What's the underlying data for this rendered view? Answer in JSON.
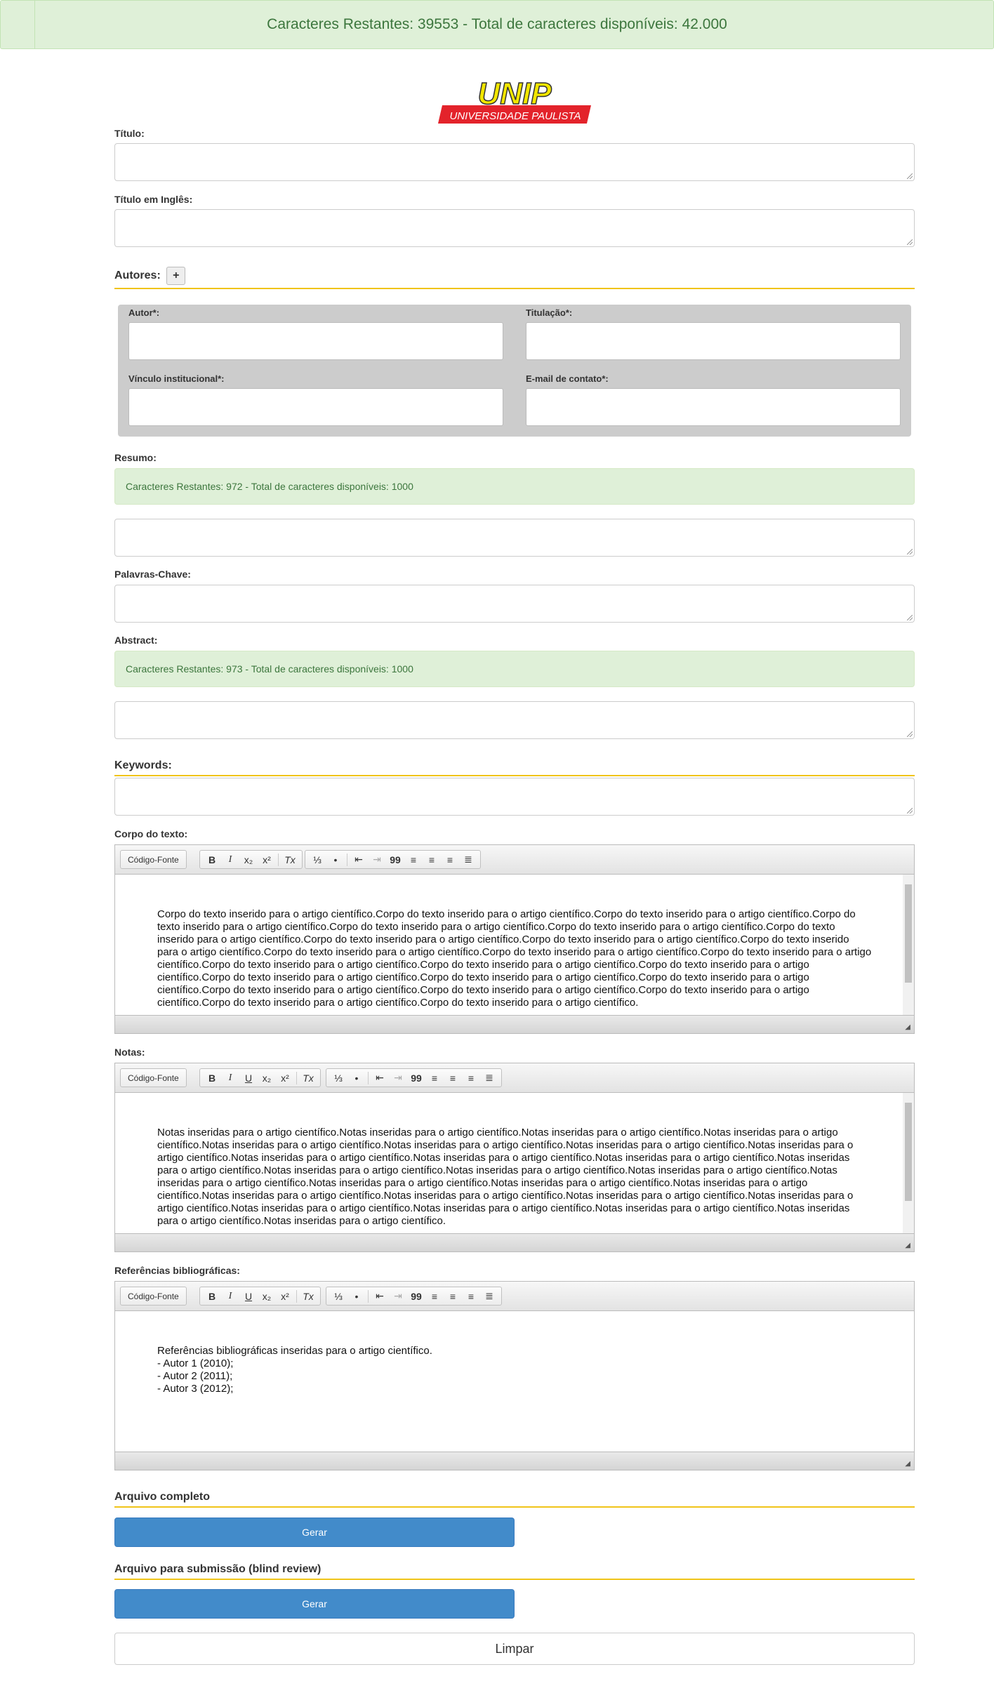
{
  "top_counter": "Caracteres Restantes: 39553 - Total de caracteres disponíveis: 42.000",
  "logo": {
    "name": "UNIP",
    "subtitle": "UNIVERSIDADE PAULISTA",
    "colors": {
      "yellow": "#f2e600",
      "red": "#e3232b"
    }
  },
  "fields": {
    "titulo": {
      "label": "Título:",
      "value": ""
    },
    "titulo_en": {
      "label": "Título em Inglês:",
      "value": ""
    },
    "palavras": {
      "label": "Palavras-Chave:",
      "value": ""
    }
  },
  "authors": {
    "heading": "Autores:",
    "add_label": "+",
    "autor": "Autor*:",
    "titulacao": "Titulação*:",
    "vinculo": "Vínculo institucional*:",
    "email": "E-mail de contato*:"
  },
  "resumo": {
    "label": "Resumo:",
    "counter": "Caracteres Restantes: 972 - Total de caracteres disponíveis: 1000"
  },
  "abstract": {
    "label": "Abstract:",
    "counter": "Caracteres Restantes: 973 - Total de caracteres disponíveis: 1000"
  },
  "keywords": {
    "heading": "Keywords:"
  },
  "toolbar": {
    "source": "Código-Fonte",
    "bold": "B",
    "italic": "I",
    "underline": "U",
    "sub": "x₂",
    "sup": "x²",
    "clear": "Tx",
    "ol": "⅓",
    "ul": "•",
    "outdent": "⇤",
    "indent": "⇥",
    "quote": "99"
  },
  "corpo": {
    "label": "Corpo do texto:",
    "text": "Corpo do texto inserido para o artigo científico.Corpo do texto inserido para o artigo científico.Corpo do texto inserido para o artigo científico.Corpo do texto inserido para o artigo científico.Corpo do texto inserido para o artigo científico.Corpo do texto inserido para o artigo científico.Corpo do texto inserido para o artigo científico.Corpo do texto inserido para o artigo científico.Corpo do texto inserido para o artigo científico.Corpo do texto inserido para o artigo científico.Corpo do texto inserido para o artigo científico.Corpo do texto inserido para o artigo científico.Corpo do texto inserido para o artigo científico.Corpo do texto inserido para o artigo científico.Corpo do texto inserido para o artigo científico.Corpo do texto inserido para o artigo científico.Corpo do texto inserido para o artigo científico.Corpo do texto inserido para o artigo científico.Corpo do texto inserido para o artigo científico.Corpo do texto inserido para o artigo científico.Corpo do texto inserido para o artigo científico.Corpo do texto inserido para o artigo científico.Corpo do texto inserido para o artigo científico.Corpo do texto inserido para o artigo científico."
  },
  "notas": {
    "label": "Notas:",
    "text": "Notas inseridas para o artigo científico.Notas inseridas para o artigo científico.Notas inseridas para o artigo científico.Notas inseridas para o artigo científico.Notas inseridas para o artigo científico.Notas inseridas para o artigo científico.Notas inseridas para o artigo científico.Notas inseridas para o artigo científico.Notas inseridas para o artigo científico.Notas inseridas para o artigo científico.Notas inseridas para o artigo científico.Notas inseridas para o artigo científico.Notas inseridas para o artigo científico.Notas inseridas para o artigo científico.Notas inseridas para o artigo científico.Notas inseridas para o artigo científico.Notas inseridas para o artigo científico.Notas inseridas para o artigo científico.Notas inseridas para o artigo científico.Notas inseridas para o artigo científico.Notas inseridas para o artigo científico.Notas inseridas para o artigo científico.Notas inseridas para o artigo científico.Notas inseridas para o artigo científico.Notas inseridas para o artigo científico.Notas inseridas para o artigo científico.Notas inseridas para o artigo científico.Notas inseridas para o artigo científico."
  },
  "referencias": {
    "label": "Referências bibliográficas:",
    "lines": [
      "Referências bibliográficas inseridas para o artigo científico.",
      "- Autor 1 (2010);",
      "- Autor 2 (2011);",
      "- Autor 3 (2012);"
    ]
  },
  "arquivo_completo": {
    "heading": "Arquivo completo",
    "button": "Gerar"
  },
  "arquivo_blind": {
    "heading": "Arquivo para submissão (blind review)",
    "button": "Gerar"
  },
  "clear_button": "Limpar"
}
